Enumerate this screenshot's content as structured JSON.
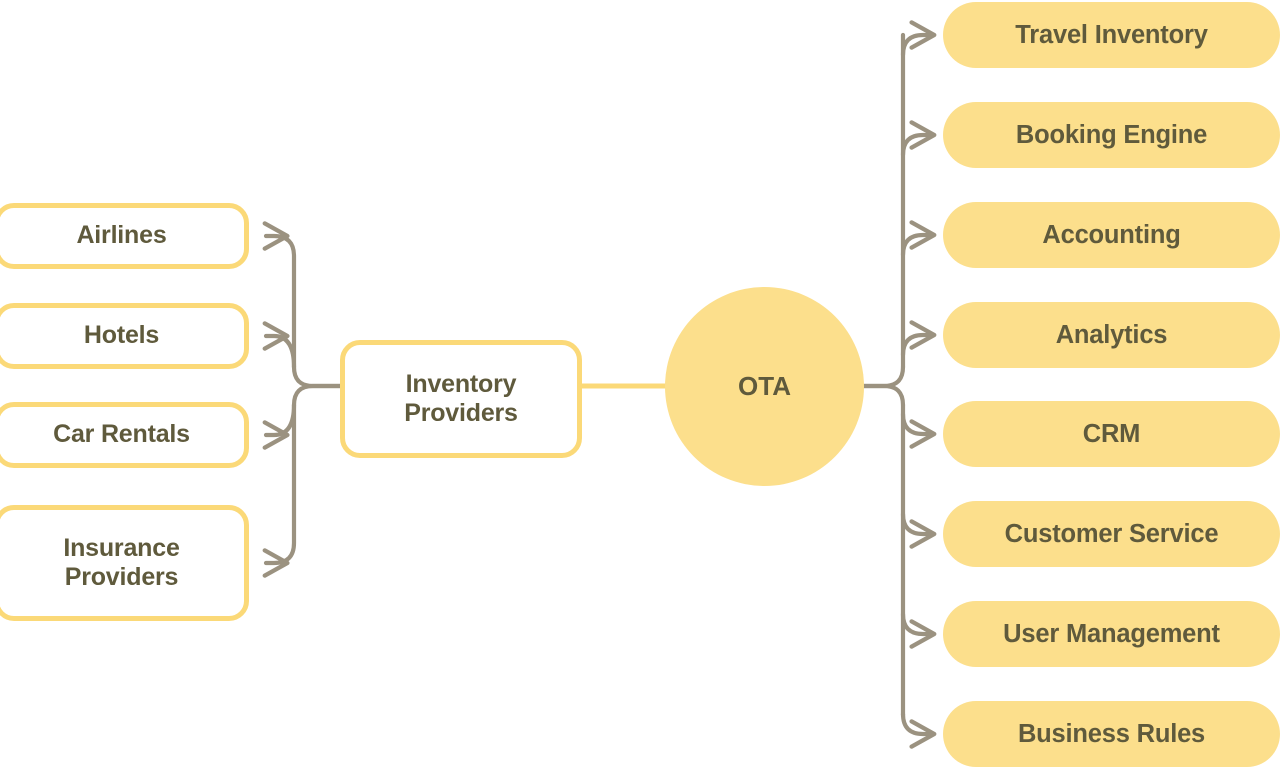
{
  "diagram": {
    "title": "OTA",
    "type": "mind-map",
    "colors": {
      "node_fill": "#fcdf8c",
      "node_border": "#fbd978",
      "text": "#5f5a3c",
      "connector": "#9b9280",
      "center_link": "#fbd978",
      "background": "#ffffff"
    },
    "root": {
      "label": "OTA",
      "shape": "circle"
    },
    "left_branch": {
      "parent": {
        "label": "Inventory\nProviders"
      },
      "children": [
        {
          "label": "Airlines"
        },
        {
          "label": "Hotels"
        },
        {
          "label": "Car Rentals"
        },
        {
          "label": "Insurance\nProviders"
        }
      ]
    },
    "right_branch": {
      "children": [
        {
          "label": "Travel Inventory"
        },
        {
          "label": "Booking Engine"
        },
        {
          "label": "Accounting"
        },
        {
          "label": "Analytics"
        },
        {
          "label": "CRM"
        },
        {
          "label": "Customer Service"
        },
        {
          "label": "User Management"
        },
        {
          "label": "Business Rules"
        }
      ]
    }
  }
}
